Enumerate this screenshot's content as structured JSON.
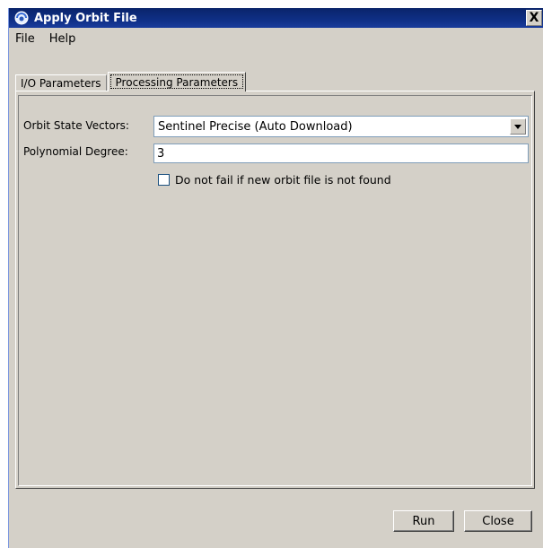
{
  "window": {
    "title": "Apply Orbit File",
    "close_glyph": "X"
  },
  "menu": {
    "items": [
      "File",
      "Help"
    ]
  },
  "tabs": [
    {
      "label": "I/O Parameters",
      "active": false
    },
    {
      "label": "Processing Parameters",
      "active": true
    }
  ],
  "form": {
    "orbit_label": "Orbit State Vectors:",
    "orbit_value": "Sentinel Precise (Auto Download)",
    "poly_label": "Polynomial Degree:",
    "poly_value": "3",
    "nofail_label": "Do not fail if new orbit file is not found",
    "nofail_checked": false
  },
  "buttons": {
    "run": "Run",
    "close": "Close"
  },
  "icons": {
    "app": "snap-app-icon",
    "dropdown": "chevron-down-icon"
  },
  "colors": {
    "title_bar": "#0a246a",
    "window_bg": "#d4d0c8"
  }
}
